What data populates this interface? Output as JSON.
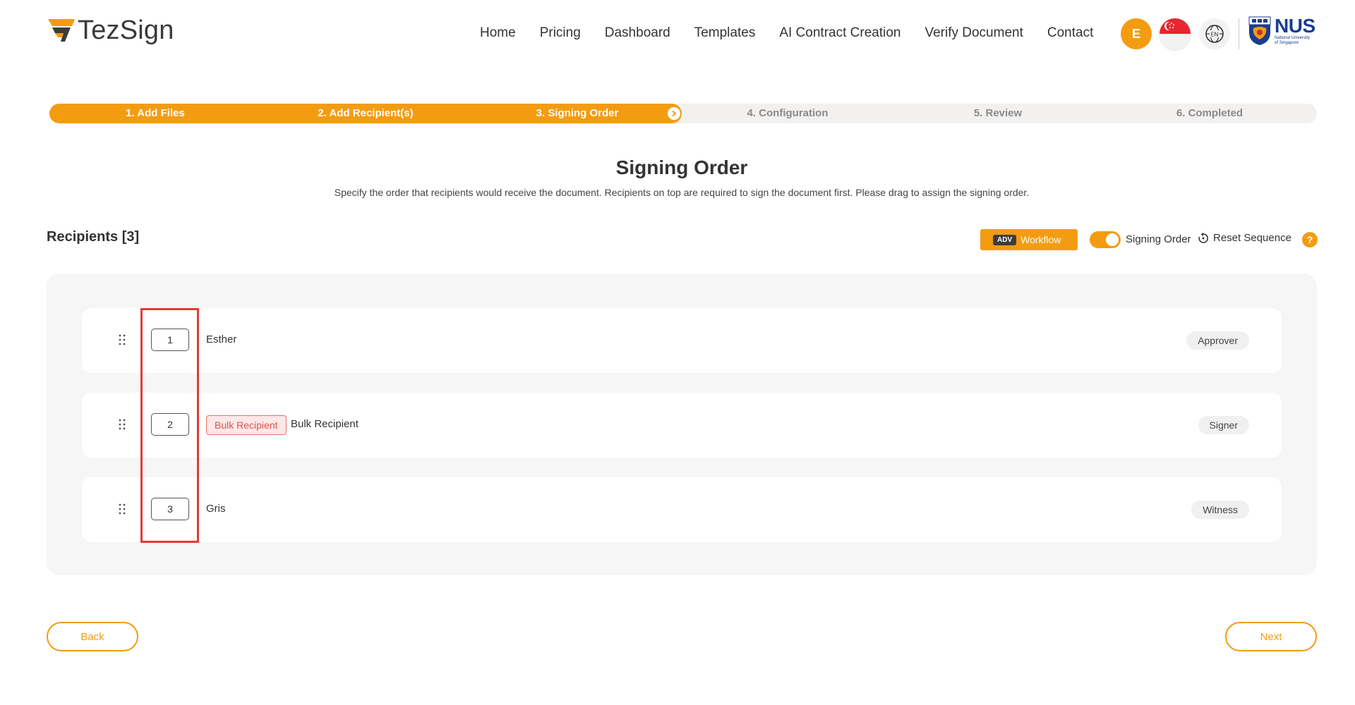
{
  "brand": {
    "name": "TezSign",
    "accent": "#f39c12"
  },
  "nav": [
    "Home",
    "Pricing",
    "Dashboard",
    "Templates",
    "AI Contract Creation",
    "Verify Document",
    "Contact"
  ],
  "user": {
    "initial": "E"
  },
  "language": {
    "code": "EN",
    "flag": "singapore-flag-icon"
  },
  "partner": {
    "name": "NUS",
    "sub1": "National University",
    "sub2": "of Singapore"
  },
  "stepper": {
    "steps": [
      "1. Add Files",
      "2. Add Recipient(s)",
      "3. Signing Order",
      "4. Configuration",
      "5. Review",
      "6. Completed"
    ],
    "current": 3
  },
  "page": {
    "title": "Signing Order",
    "subtitle": "Specify the order that recipients would receive the document. Recipients on top are required to sign the document first. Please drag to assign the signing order."
  },
  "recipients": {
    "heading": "Recipients [3]",
    "adv_tag": "ADV",
    "workflow_label": "Workflow",
    "signing_order_label": "Signing Order",
    "signing_order_enabled": true,
    "reset_label": "Reset Sequence",
    "help_label": "?",
    "rows": [
      {
        "order": "1",
        "name": "Esther",
        "tag": "",
        "role": "Approver"
      },
      {
        "order": "2",
        "name": "Bulk Recipient",
        "tag": "Bulk Recipient",
        "role": "Signer"
      },
      {
        "order": "3",
        "name": "Gris",
        "tag": "",
        "role": "Witness"
      }
    ]
  },
  "footer": {
    "back_label": "Back",
    "next_label": "Next"
  }
}
